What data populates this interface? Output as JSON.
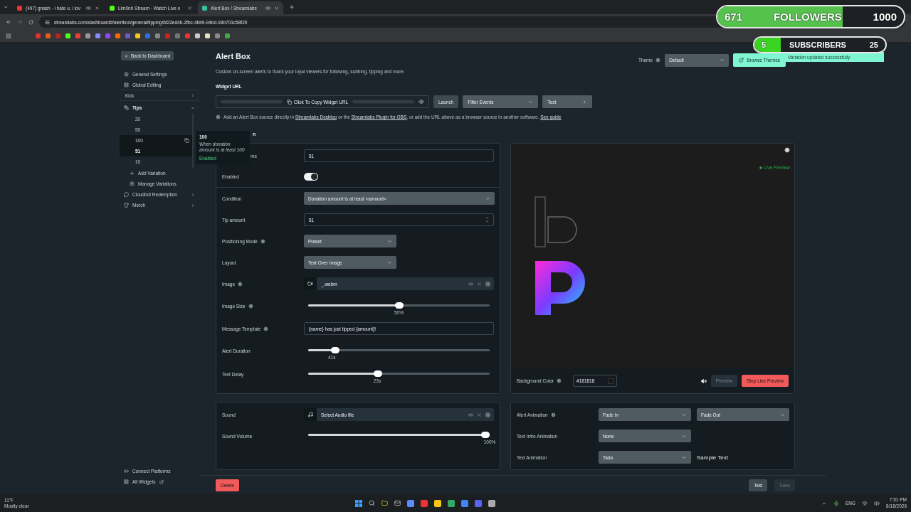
{
  "browser": {
    "tabs": [
      {
        "title": "(497) gnash - i hate u, i lov",
        "selected": false,
        "audio": true,
        "kind": "video"
      },
      {
        "title": "Lim0nh Stream - Watch Live o",
        "selected": false,
        "audio": false,
        "kind": "stream"
      },
      {
        "title": "Alert Box / Streamlabs",
        "selected": true,
        "audio": true,
        "kind": "widget"
      }
    ],
    "url": "streamlabs.com/dashboard#/alertbox/general/tipping/6f22ed4b-2fbc-4bb9-94bd-93b701c58f20"
  },
  "overlay": {
    "followers": {
      "count": "671",
      "label": "FOLLOWERS",
      "goal": "1000",
      "level": 0.671
    },
    "subscribers": {
      "count": "5",
      "label": "SUBSCRIBERS",
      "goal": "25",
      "level": 0.2
    },
    "toast": "Variation updated successfully"
  },
  "sidebar": {
    "back": "Back to Dashboard",
    "items": [
      {
        "kind": "settings",
        "label": "General Settings"
      },
      {
        "kind": "grid",
        "label": "Global Editing"
      },
      {
        "kind": "platform",
        "label": "Kick"
      },
      {
        "kind": "group",
        "label": "Tips",
        "expanded": true,
        "variations": [
          {
            "label": "20",
            "selected": false,
            "hovered": false
          },
          {
            "label": "50",
            "selected": false,
            "hovered": false
          },
          {
            "label": "100",
            "selected": false,
            "hovered": true
          },
          {
            "label": "51",
            "selected": true,
            "hovered": false
          },
          {
            "label": "10",
            "selected": false,
            "hovered": false
          }
        ],
        "add": "Add Variation",
        "manage": "Manage Variations"
      },
      {
        "kind": "chat",
        "label": "Cloudbot Redemption"
      },
      {
        "kind": "shirt",
        "label": "Merch"
      }
    ],
    "bottom": [
      {
        "kind": "link",
        "label": "Connect Platforms"
      },
      {
        "kind": "external",
        "label": "All Widgets"
      }
    ]
  },
  "tooltip": {
    "title": "100",
    "description": "When donation amount is at least 100",
    "status": "Enabled"
  },
  "header": {
    "title": "Alert Box",
    "description": "Custom on-screen alerts to thank your loyal viewers for following, subbing, tipping and more.",
    "theme_label": "Theme",
    "theme": "Default",
    "browse": "Browse Themes"
  },
  "widget": {
    "label": "Widget URL",
    "copy": "Click To Copy Widget URL",
    "launch": "Launch",
    "filter": "Filter Events",
    "test": "Test",
    "info": [
      {
        "text": "Add an Alert Box source directly in ",
        "link": false
      },
      {
        "text": "Streamlabs Desktop",
        "link": true
      },
      {
        "text": " or the ",
        "link": false
      },
      {
        "text": "Streamlabs Plugin for OBS",
        "link": true
      },
      {
        "text": ", or add the URL above as a browser source in another software. ",
        "link": false
      },
      {
        "text": "See guide",
        "link": true
      }
    ]
  },
  "section_heading": "n",
  "form": [
    {
      "kind": "text",
      "label": "me",
      "info": false,
      "value": "51"
    },
    {
      "kind": "toggle",
      "label": "Enabled",
      "info": false,
      "on": true
    },
    {
      "kind": "select",
      "label": "Condition",
      "info": false,
      "value": "Donation amount is at least <amount>",
      "wide": true
    },
    {
      "kind": "number",
      "label": "Tip amount",
      "info": false,
      "value": "51"
    },
    {
      "kind": "select",
      "label": "Positioning Mode",
      "info": true,
      "value": "Preset",
      "wide": false
    },
    {
      "kind": "select",
      "label": "Layout",
      "info": false,
      "value": "Text Over Image",
      "wide": false
    },
    {
      "kind": "video_file",
      "label": "Image",
      "info": true,
      "value": "_.webm"
    },
    {
      "kind": "slider",
      "label": "Image Size",
      "info": true,
      "level": 0.5,
      "reading": "50%"
    },
    {
      "kind": "input",
      "label": "Message Template",
      "info": true,
      "value": "{name} has just tipped {amount}!"
    },
    {
      "kind": "slider",
      "label": "Alert Duration",
      "info": false,
      "level": 0.13,
      "reading": "41s"
    },
    {
      "kind": "slider",
      "label": "Text Delay",
      "info": false,
      "level": 0.38,
      "reading": "23s"
    }
  ],
  "preview": {
    "live": "Live Preview",
    "bg_label": "Background Color",
    "bg_value": "#181818",
    "color": "#181818",
    "preview": "Preview",
    "stop": "Stop Live Preview"
  },
  "sound": [
    {
      "kind": "audio_file",
      "label": "Sound",
      "info": false,
      "value": "Select Audio file"
    },
    {
      "kind": "slider",
      "label": "Sound Volume",
      "info": false,
      "level": 1,
      "reading": "100%"
    }
  ],
  "animation": [
    {
      "label": "Alert Animation",
      "info": true,
      "selects": [
        "Fade In",
        "Fade Out"
      ]
    },
    {
      "label": "Text Intro Animation",
      "info": false,
      "selects": [
        "None"
      ]
    },
    {
      "label": "Text Animation",
      "info": false,
      "selects": [
        "Tada"
      ],
      "sample": "Sample Text"
    }
  ],
  "footer": {
    "delete": "Delete",
    "test": "Test",
    "save": "Save",
    "save_disabled": true
  },
  "taskbar": {
    "temp": "11°F",
    "weather": "Mostly clear",
    "lang": "ENG",
    "time": "7:51 PM",
    "date": "8/18/2026"
  }
}
